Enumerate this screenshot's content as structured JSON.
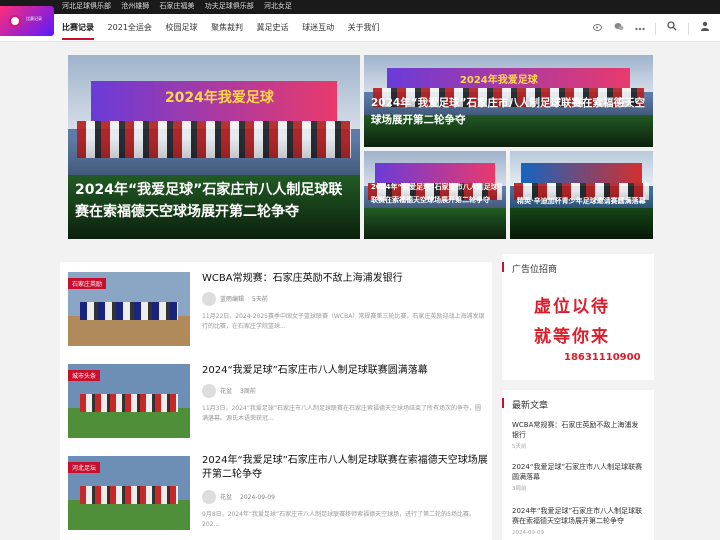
{
  "topbar": {
    "links": [
      "河北足球俱乐部",
      "沧州雄狮",
      "石家庄福美",
      "功夫足球俱乐部",
      "河北女足"
    ]
  },
  "logo": {
    "text": "比赛记录"
  },
  "nav": {
    "items": [
      "比赛记录",
      "2021全运会",
      "校园足球",
      "聚焦裁判",
      "冀足史话",
      "球迷互动",
      "关于我们"
    ],
    "icons": [
      "weibo-icon",
      "wechat-icon",
      "more-icon",
      "search-icon",
      "user-icon"
    ]
  },
  "hero": {
    "main": {
      "title": "2024年“我爱足球”石家庄市八人制足球联赛在索福德天空球场展开第二轮争夺",
      "banner": "2024年我爱足球"
    },
    "top_right": {
      "title": "2024年“我爱足球”石家庄市八人制足球联赛在索福德天空球场展开第二轮争夺",
      "banner": "2024年我爱足球"
    },
    "bottom_left": {
      "title": "2024年“我爱足球”石家庄市八人制足球联赛在索福德天空球场展开第二轮争夺"
    },
    "bottom_right": {
      "title": "精英·辛迪加杯青少年足球邀请赛圆满落幕"
    }
  },
  "articles": [
    {
      "tag": "石家庄英励",
      "title": "WCBA常规赛：石家庄英励不敌上海浦发银行",
      "author": "蓝雨编辑",
      "time": "5天前",
      "desc": "11月22日，2024-2025赛季中国女子篮球联赛（WCBA）常规赛第三轮比赛，石家庄英励迎战上海浦发银行的比赛，在石家庄学院篮球..."
    },
    {
      "tag": "城市头条",
      "title": "2024“我爱足球”石家庄市八人制足球联赛圆满落幕",
      "author": "花盆",
      "time": "3周前",
      "desc": "11月3日，2024“我爱足球”石家庄市八人制足球联赛在石家庄索福德天空球场结束了所有场次的争夺，圆满落幕。源氏木语荣获冠..."
    },
    {
      "tag": "河北足坛",
      "title": "2024年“我爱足球”石家庄市八人制足球联赛在索福德天空球场展开第二轮争夺",
      "author": "花盆",
      "time": "2024-09-09",
      "desc": "9月8日，2024年“我爱足球”石家庄市八人制足球联赛移师索福德天空球场，进行了第二轮的5场比赛。202..."
    }
  ],
  "sidebar": {
    "ad": {
      "heading": "广告位招商",
      "line1": "虚位以待",
      "line2": "就等你来",
      "phone": "18631110900"
    },
    "latest": {
      "heading": "最新文章",
      "items": [
        {
          "title": "WCBA常规赛：石家庄英励不敌上海浦发银行",
          "date": "5天前"
        },
        {
          "title": "2024“我爱足球”石家庄市八人制足球联赛圆满落幕",
          "date": "3周前"
        },
        {
          "title": "2024年“我爱足球”石家庄市八人制足球联赛在索福德天空球场展开第二轮争夺",
          "date": "2024-09-09"
        }
      ]
    }
  },
  "colors": {
    "accent": "#c8102e",
    "ad_red": "#d81e2b",
    "topbar": "#1a1a1a"
  }
}
